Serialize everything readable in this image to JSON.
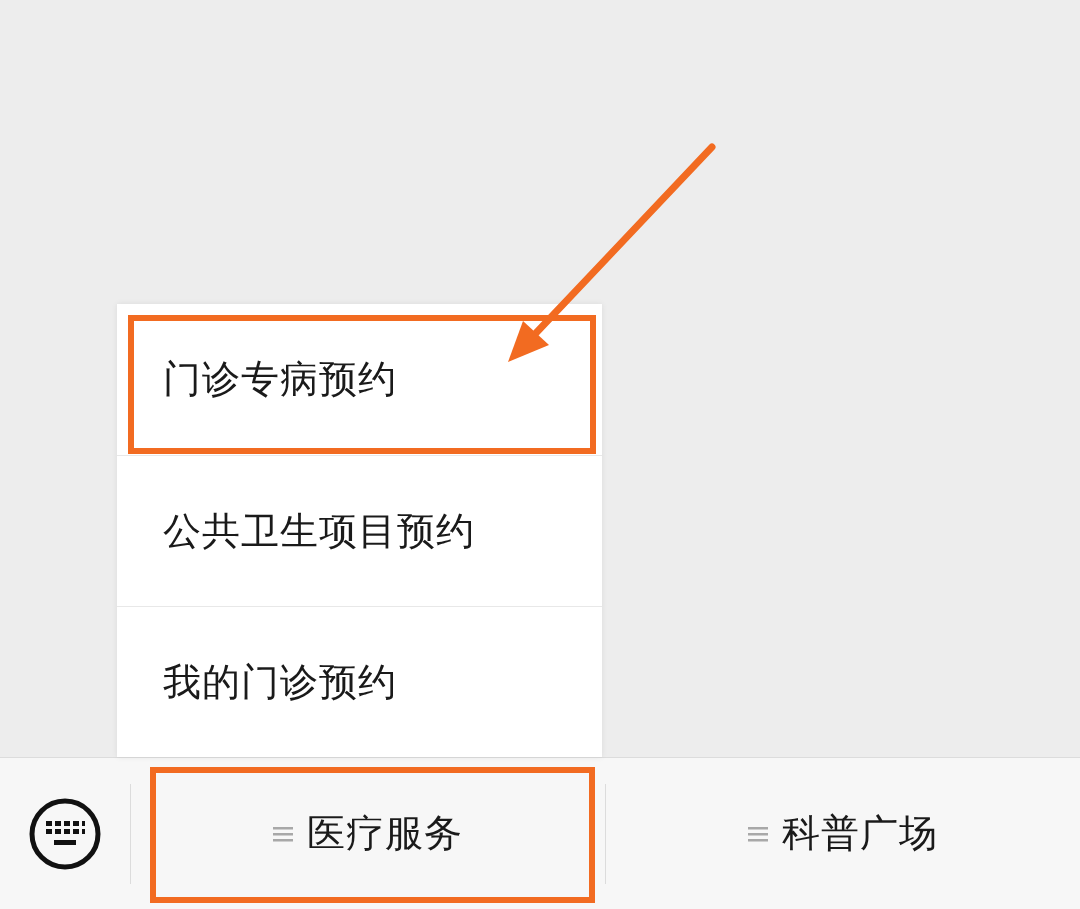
{
  "menu_popup": {
    "items": [
      {
        "label": "门诊专病预约",
        "highlighted": true,
        "arrow": true
      },
      {
        "label": "公共卫生项目预约",
        "highlighted": false,
        "arrow": false
      },
      {
        "label": "我的门诊预约",
        "highlighted": false,
        "arrow": false
      }
    ]
  },
  "bottom_menu": {
    "buttons": [
      {
        "label": "医疗服务",
        "expanded": true,
        "highlighted": true
      },
      {
        "label": "科普广场",
        "expanded": false,
        "highlighted": false
      }
    ]
  }
}
